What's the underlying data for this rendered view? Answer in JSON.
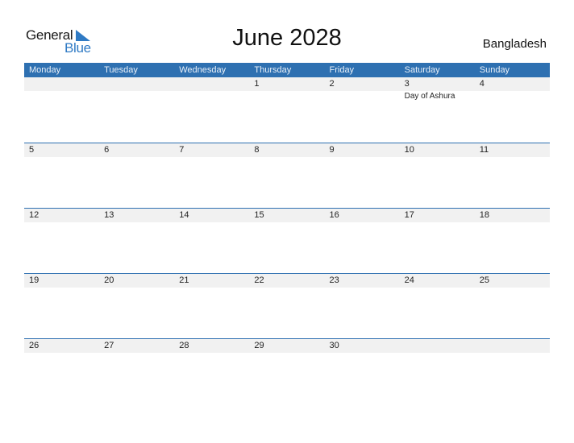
{
  "logo": {
    "word1": "General",
    "word2": "Blue"
  },
  "header": {
    "title": "June 2028",
    "country": "Bangladesh"
  },
  "calendar": {
    "weekdays": [
      "Monday",
      "Tuesday",
      "Wednesday",
      "Thursday",
      "Friday",
      "Saturday",
      "Sunday"
    ],
    "weeks": [
      {
        "days": [
          "",
          "",
          "",
          "1",
          "2",
          "3",
          "4"
        ],
        "events": [
          "",
          "",
          "",
          "",
          "",
          "Day of Ashura",
          ""
        ]
      },
      {
        "days": [
          "5",
          "6",
          "7",
          "8",
          "9",
          "10",
          "11"
        ],
        "events": [
          "",
          "",
          "",
          "",
          "",
          "",
          ""
        ]
      },
      {
        "days": [
          "12",
          "13",
          "14",
          "15",
          "16",
          "17",
          "18"
        ],
        "events": [
          "",
          "",
          "",
          "",
          "",
          "",
          ""
        ]
      },
      {
        "days": [
          "19",
          "20",
          "21",
          "22",
          "23",
          "24",
          "25"
        ],
        "events": [
          "",
          "",
          "",
          "",
          "",
          "",
          ""
        ]
      },
      {
        "days": [
          "26",
          "27",
          "28",
          "29",
          "30",
          "",
          ""
        ],
        "events": [
          "",
          "",
          "",
          "",
          "",
          "",
          ""
        ]
      }
    ]
  },
  "colors": {
    "accent": "#2e70b1",
    "logo_blue": "#2f7ac4",
    "strip": "#f1f1f1"
  }
}
